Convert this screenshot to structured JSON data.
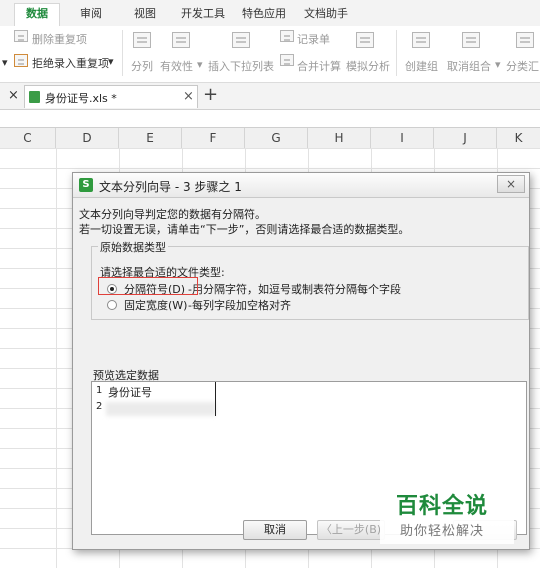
{
  "ribbon": {
    "tabs": [
      "数据",
      "审阅",
      "视图",
      "开发工具",
      "特色应用",
      "文档助手"
    ],
    "active_tab": "数据"
  },
  "toolbar": {
    "remove_duplicates": "删除重复项",
    "reject_duplicates": "拒绝录入重复项",
    "split_columns": "分列",
    "validity": "有效性",
    "dropdown_list": "插入下拉列表",
    "record_list": "记录单",
    "merge_calc": "合并计算",
    "what_if": "模拟分析",
    "create_group": "创建组",
    "ungroup": "取消组合",
    "subtotal": "分类汇"
  },
  "document": {
    "tab_title": "身份证号.xls *",
    "close_glyph": "×",
    "add_glyph": "+"
  },
  "sheet": {
    "left_marker": "×",
    "columns": [
      "C",
      "D",
      "E",
      "F",
      "G",
      "H",
      "I",
      "J",
      "K"
    ]
  },
  "dialog": {
    "title": "文本分列向导 - 3 步骤之 1",
    "close_glyph": "×",
    "intro_line1": "文本分列向导判定您的数据有分隔符。",
    "intro_line2": "若一切设置无误，请单击“下一步”，否则请选择最合适的数据类型。",
    "group_title": "原始数据类型",
    "choose_label": "请选择最合适的文件类型:",
    "options": [
      {
        "label": "分隔符号(D)",
        "desc": "-用分隔字符，如逗号或制表符分隔每个字段",
        "selected": true
      },
      {
        "label": "固定宽度(W)",
        "desc": "-每列字段加空格对齐",
        "selected": false
      }
    ],
    "preview_label": "预览选定数据",
    "preview_rows": [
      {
        "num": "1",
        "text": "身份证号"
      },
      {
        "num": "2",
        "text": ""
      }
    ],
    "buttons": {
      "cancel": "取消",
      "back": "〈上一步(B)"
    }
  },
  "watermark": {
    "main": "百科全说",
    "sub": "助你轻松解决"
  },
  "colors": {
    "accent_green": "#1f8a3c",
    "highlight_red": "#e0403a"
  }
}
